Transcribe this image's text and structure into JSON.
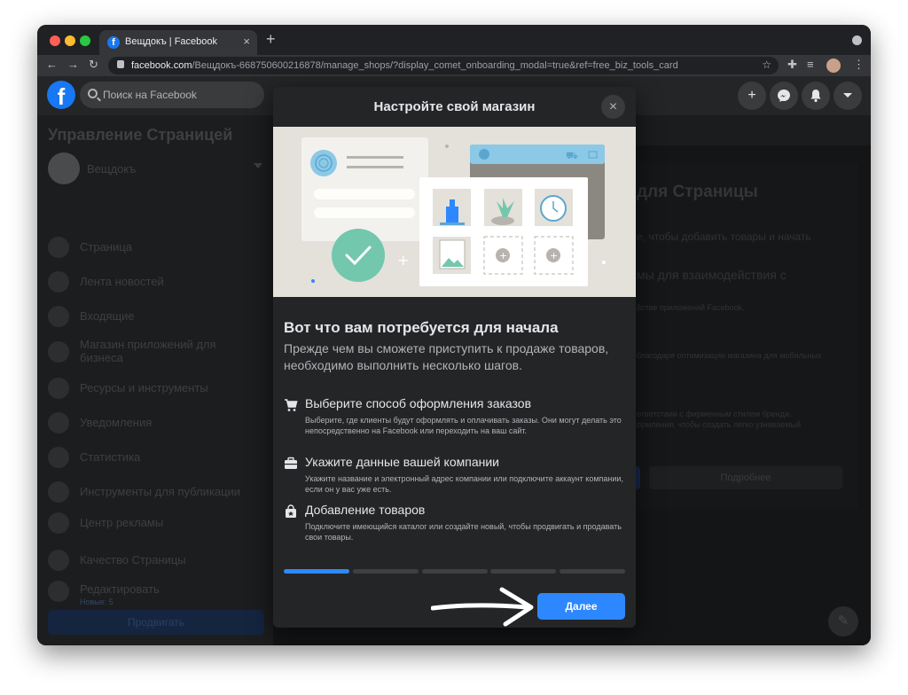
{
  "browser": {
    "tab_title": "Вещдокъ | Facebook",
    "tab_close": "×",
    "new_tab": "+",
    "url_domain": "facebook.com",
    "url_path": "/Вещдокъ-668750600216878/manage_shops/?display_comet_onboarding_modal=true&ref=free_biz_tools_card"
  },
  "fb_header": {
    "logo": "f",
    "search_placeholder": "Поиск на Facebook",
    "buttons": [
      "plus-icon",
      "messenger-icon",
      "bell-icon",
      "caret-down-icon"
    ]
  },
  "sidebar": {
    "title": "Управление Страницей",
    "page_name": "Вещдокъ",
    "items": [
      {
        "label": "Страница",
        "icon": "flag-icon"
      },
      {
        "label": "Лента новостей",
        "icon": "news-feed-icon"
      },
      {
        "label": "Входящие",
        "icon": "inbox-icon"
      },
      {
        "label": "Магазин приложений для бизнеса",
        "icon": "app-store-icon"
      },
      {
        "label": "Ресурсы и инструменты",
        "icon": "info-icon"
      },
      {
        "label": "Уведомления",
        "icon": "bell-icon"
      },
      {
        "label": "Статистика",
        "icon": "chart-icon"
      },
      {
        "label": "Инструменты для публикации",
        "icon": "publishing-icon"
      },
      {
        "label": "Центр рекламы",
        "icon": "megaphone-icon"
      },
      {
        "label": "Качество Страницы",
        "icon": "shield-icon"
      },
      {
        "label": "Редактировать",
        "sub": "Новые: 5",
        "icon": "pencil-icon"
      }
    ],
    "promote_label": "Продвигать"
  },
  "background_main": {
    "heading": "для Страницы",
    "lines": [
      "е, чтобы добавить товары и начать",
      "мы для взаимодействия с",
      "йстве приложений Facebook.",
      "благодаря оптимизации магазина для мобильных",
      "ответствии с фирменным стилем бренда.",
      "ормления, чтобы создать легко узнаваемый"
    ],
    "more_button": "Подробнее"
  },
  "modal": {
    "title": "Настройте свой магазин",
    "close": "×",
    "heading": "Вот что вам потребуется для начала",
    "intro": "Прежде чем вы сможете приступить к продаже товаров, необходимо выполнить несколько шагов.",
    "steps": [
      {
        "icon": "cart-icon",
        "title": "Выберите способ оформления заказов",
        "desc": "Выберите, где клиенты будут оформлять и оплачивать заказы. Они могут делать это непосредственно на Facebook или переходить на ваш сайт."
      },
      {
        "icon": "briefcase-icon",
        "title": "Укажите данные вашей компании",
        "desc": "Укажите название и электронный адрес компании или подключите аккаунт компании, если он у вас уже есть."
      },
      {
        "icon": "shopping-bag-icon",
        "title": "Добавление товаров",
        "desc": "Подключите имеющийся каталог или создайте новый, чтобы продвигать и продавать свои товары."
      }
    ],
    "progress": {
      "total_steps": 5,
      "current_step": 1
    },
    "next_button": "Далее"
  },
  "colors": {
    "accent": "#2d88ff",
    "fb_blue": "#1877f2",
    "modal_bg": "#242526",
    "illustration_bg": "#e4e1da",
    "check_green": "#73c7ad"
  }
}
